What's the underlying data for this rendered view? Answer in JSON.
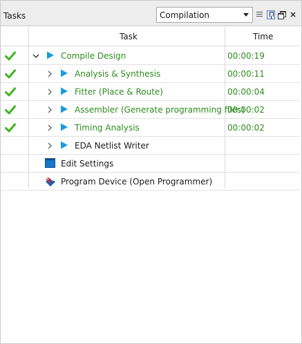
{
  "panel": {
    "title": "Tasks",
    "flow_selector": {
      "value": "Compilation"
    },
    "toolbar_icons": [
      "list-icon",
      "pin-icon",
      "float-icon",
      "close-icon"
    ]
  },
  "table": {
    "columns": [
      "Task",
      "Time"
    ],
    "rows": [
      {
        "status": "check-icon",
        "expandable": "chevron-down-icon",
        "icon": "play-icon",
        "label": "Compile Design",
        "time": "00:00:19",
        "color": "#2e8b1f"
      },
      {
        "status": "check-icon",
        "expandable": "chevron-right-icon",
        "icon": "play-icon",
        "label": "Analysis & Synthesis",
        "time": "00:00:11",
        "color": "#2e8b1f"
      },
      {
        "status": "check-icon",
        "expandable": "chevron-right-icon",
        "icon": "play-icon",
        "label": "Fitter (Place & Route)",
        "time": "00:00:04",
        "color": "#2e8b1f"
      },
      {
        "status": "check-icon",
        "expandable": "chevron-right-icon",
        "icon": "play-icon",
        "label": "Assembler (Generate programming files)",
        "time": "00:00:02",
        "color": "#2e8b1f"
      },
      {
        "status": "check-icon",
        "expandable": "chevron-right-icon",
        "icon": "play-icon",
        "label": "Timing Analysis",
        "time": "00:00:02",
        "color": "#2e8b1f"
      },
      {
        "status": "",
        "expandable": "chevron-right-icon",
        "icon": "play-icon",
        "label": "EDA Netlist Writer",
        "time": "",
        "color": "#1a1a1a"
      },
      {
        "status": "",
        "expandable": "",
        "icon": "settings-icon",
        "label": "Edit Settings",
        "time": "",
        "color": "#1a1a1a"
      },
      {
        "status": "",
        "expandable": "",
        "icon": "programmer-icon",
        "label": "Program Device (Open Programmer)",
        "time": "",
        "color": "#1a1a1a"
      }
    ]
  },
  "colors": {
    "success": "#2e8b1f",
    "run_icon": "#1a9be0",
    "check": "#3cb521"
  }
}
